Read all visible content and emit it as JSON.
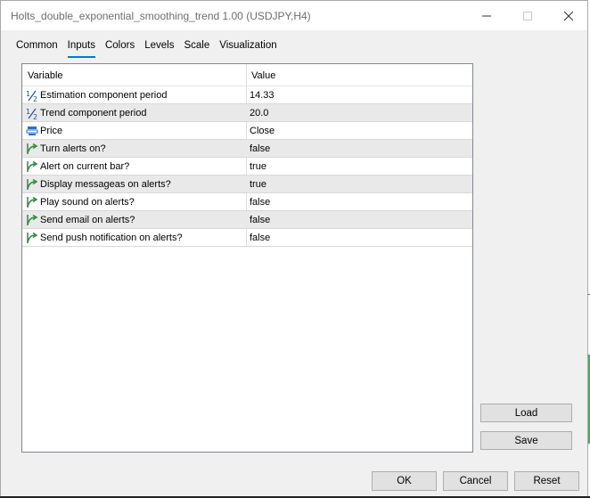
{
  "window": {
    "title": "Holts_double_exponential_smoothing_trend 1.00 (USDJPY,H4)",
    "controls": [
      "minimize",
      "maximize",
      "close"
    ]
  },
  "tabs": [
    {
      "label": "Common",
      "active": false
    },
    {
      "label": "Inputs",
      "active": true
    },
    {
      "label": "Colors",
      "active": false
    },
    {
      "label": "Levels",
      "active": false
    },
    {
      "label": "Scale",
      "active": false
    },
    {
      "label": "Visualization",
      "active": false
    }
  ],
  "table": {
    "headers": {
      "variable": "Variable",
      "value": "Value"
    },
    "rows": [
      {
        "icon": "fraction-icon",
        "variable": "Estimation component period",
        "value": "14.33"
      },
      {
        "icon": "fraction-icon",
        "variable": "Trend component period",
        "value": "20.0"
      },
      {
        "icon": "list-icon",
        "variable": "Price",
        "value": "Close"
      },
      {
        "icon": "bool-arrow-icon",
        "variable": "Turn alerts on?",
        "value": "false"
      },
      {
        "icon": "bool-arrow-icon",
        "variable": "Alert on current bar?",
        "value": "true"
      },
      {
        "icon": "bool-arrow-icon",
        "variable": "Display messageas on alerts?",
        "value": "true"
      },
      {
        "icon": "bool-arrow-icon",
        "variable": "Play sound on alerts?",
        "value": "false"
      },
      {
        "icon": "bool-arrow-icon",
        "variable": "Send email on alerts?",
        "value": "false"
      },
      {
        "icon": "bool-arrow-icon",
        "variable": "Send push notification on alerts?",
        "value": "false"
      }
    ]
  },
  "side_buttons": {
    "load": "Load",
    "save": "Save"
  },
  "footer_buttons": {
    "ok": "OK",
    "cancel": "Cancel",
    "reset": "Reset"
  },
  "colors": {
    "accent": "#0078d7",
    "alt_row": "#e9e9e9",
    "button": "#e1e1e1"
  }
}
